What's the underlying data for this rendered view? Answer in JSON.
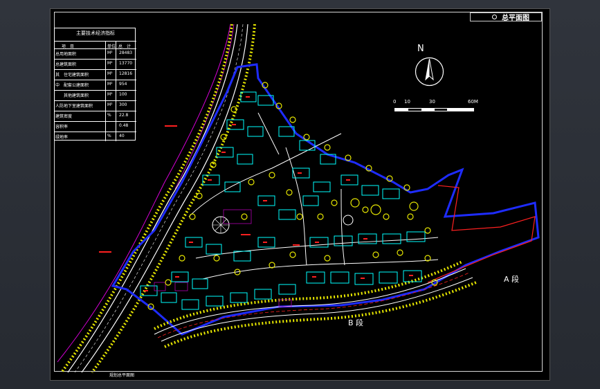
{
  "title": "总平面图",
  "north_label": "N",
  "scale_labels": [
    "0",
    "10",
    "30",
    "60M"
  ],
  "section_labels": {
    "a": "A  段",
    "b": "B  段"
  },
  "footer": "规划总平面图",
  "table": {
    "title": "主要技术经济指标",
    "header": [
      "项　目",
      "单位",
      "总　计"
    ],
    "rows": [
      {
        "item": "总用地面积",
        "unit": "M²",
        "value": "28483"
      },
      {
        "item": "总建筑面积",
        "unit": "M²",
        "value": "13770"
      },
      {
        "item": "其　住宅建筑面积",
        "unit": "M²",
        "value": "12816"
      },
      {
        "item": "中　配套公建面积",
        "unit": "M²",
        "value": "954"
      },
      {
        "item": "　　其他建筑面积",
        "unit": "M²",
        "value": "100"
      },
      {
        "item": "人防地下室建筑面积",
        "unit": "M²",
        "value": "300"
      },
      {
        "item": "建筑密度",
        "unit": "%",
        "value": "22.8"
      },
      {
        "item": "容积率",
        "unit": "",
        "value": "0.48"
      },
      {
        "item": "绿地率",
        "unit": "%",
        "value": "40"
      }
    ]
  },
  "colors": {
    "background": "#000000",
    "boundary": "#1e2cff",
    "road": "#ffffff",
    "trees": "#e6e600",
    "buildings": "#00ffff",
    "red": "#ff2020",
    "magenta": "#d600d6"
  }
}
